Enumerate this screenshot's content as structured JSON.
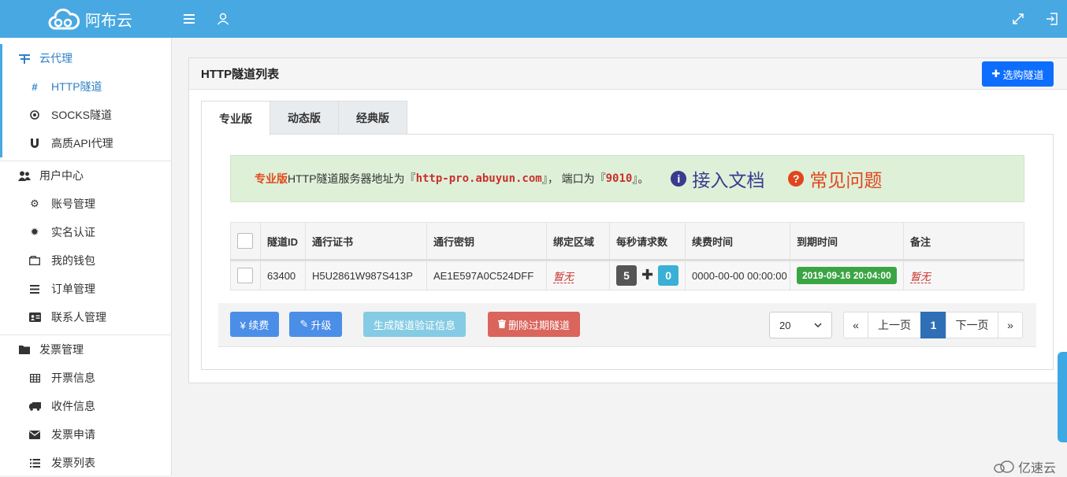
{
  "app": {
    "logo_text": "阿布云"
  },
  "colors": {
    "topbar": "#48a8e1",
    "primary": "#0d6efd",
    "active": "#2f80c7"
  },
  "topbar": {
    "menu_icon": "menu-icon",
    "user_icon": "user-icon",
    "fullscreen_icon": "expand-icon",
    "logout_icon": "logout-icon"
  },
  "sidebar": {
    "groups": [
      {
        "label": "云代理",
        "icon": "proxy-icon",
        "items": [
          {
            "label": "HTTP隧道",
            "icon": "hash-icon"
          },
          {
            "label": "SOCKS隧道",
            "icon": "target-icon"
          },
          {
            "label": "高质API代理",
            "icon": "magnet-icon"
          }
        ]
      },
      {
        "label": "用户中心",
        "icon": "users-icon",
        "items": [
          {
            "label": "账号管理",
            "icon": "gear-icon"
          },
          {
            "label": "实名认证",
            "icon": "certificate-icon"
          },
          {
            "label": "我的钱包",
            "icon": "wallet-icon"
          },
          {
            "label": "订单管理",
            "icon": "list-icon"
          },
          {
            "label": "联系人管理",
            "icon": "contact-card-icon"
          }
        ]
      },
      {
        "label": "发票管理",
        "icon": "folder-icon",
        "items": [
          {
            "label": "开票信息",
            "icon": "table-icon"
          },
          {
            "label": "收件信息",
            "icon": "truck-icon"
          },
          {
            "label": "发票申请",
            "icon": "envelope-icon"
          },
          {
            "label": "发票列表",
            "icon": "list-icon"
          }
        ]
      }
    ]
  },
  "panel": {
    "title": "HTTP隧道列表",
    "buy_button": "选购隧道",
    "tabs": [
      "专业版",
      "动态版",
      "经典版"
    ]
  },
  "notice": {
    "edition": "专业版",
    "text1": "HTTP隧道服务器地址为『",
    "host": "http-pro.abuyun.com",
    "text2": "』， 端口为『",
    "port": "9010",
    "text3": "』。",
    "doc_link": "接入文档",
    "faq_link": "常见问题"
  },
  "table": {
    "headers": [
      "隧道ID",
      "通行证书",
      "通行密钥",
      "绑定区域",
      "每秒请求数",
      "续费时间",
      "到期时间",
      "备注"
    ],
    "rows": [
      {
        "id": "63400",
        "license": "H5U2861W987S413P",
        "secret": "AE1E597A0C524DFF",
        "region": "暂无",
        "rps_base": "5",
        "rps_extra": "0",
        "renew_time": "0000-00-00 00:00:00",
        "expire_time": "2019-09-16 20:04:00",
        "note": "暂无"
      }
    ]
  },
  "toolbar": {
    "renew": "¥ 续费",
    "upgrade": "升级",
    "gen_verify": "生成隧道验证信息",
    "delete_expired": "删除过期隧道",
    "page_size": "20",
    "prev": "上一页",
    "page": "1",
    "next": "下一页",
    "first": "«",
    "last": "»"
  },
  "watermark": "亿速云"
}
